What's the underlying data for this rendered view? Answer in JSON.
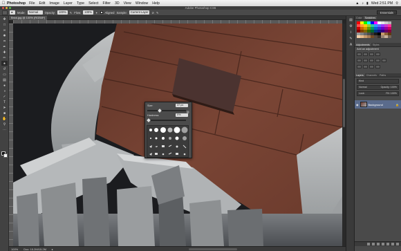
{
  "menubar": {
    "apple": "",
    "app_name": "Photoshop",
    "items": [
      "File",
      "Edit",
      "Image",
      "Layer",
      "Type",
      "Select",
      "Filter",
      "3D",
      "View",
      "Window",
      "Help"
    ],
    "clock": "Wed 2:51 PM"
  },
  "window": {
    "title": "Adobe Photoshop CS6"
  },
  "options_bar": {
    "mode_label": "Mode:",
    "mode_value": "Normal",
    "opacity_label": "Opacity:",
    "opacity_value": "100%",
    "flow_label": "Flow:",
    "flow_value": "100%",
    "aligned_label": "Aligned",
    "sample_label": "Sample:",
    "sample_value": "Current Layer",
    "workspace": "Essentials"
  },
  "document": {
    "tab_title": "Brick.jpg @ 100% (RGB/8*)",
    "zoom": "100%",
    "doc_size": "Doc: 15.2M/15.2M"
  },
  "ruler_ticks": [
    "1150",
    "1200",
    "1250",
    "1300",
    "1350",
    "1400",
    "1450",
    "1500",
    "1550",
    "1600",
    "1650",
    "1700",
    "1750",
    "1800",
    "1850",
    "1900",
    "1950",
    "2000",
    "2050",
    "2100",
    "2150",
    "2200",
    "2250",
    "2300",
    "2350",
    "2400",
    "2450",
    "2500",
    "2550",
    "2600",
    "2650",
    "2700",
    "2750",
    "2800",
    "2850",
    "2900",
    "2950",
    "3000",
    "3050",
    "3100"
  ],
  "brush_popup": {
    "size_label": "Size:",
    "size_value": "37 px",
    "hardness_label": "Hardness:",
    "hardness_value": "0%",
    "size_level": 0.3,
    "hardness_level": 0.0
  },
  "panels": {
    "top_tabs": [
      "Color",
      "Swatches"
    ],
    "adjust_tabs": [
      "Adjustments",
      "Styles"
    ],
    "adjust_label": "Add an adjustment",
    "layer_tabs": [
      "Layers",
      "Channels",
      "Paths"
    ],
    "kind_label": "Kind",
    "blend_mode": "Normal",
    "opacity_label": "Opacity: 100%",
    "lock_label": "Lock:",
    "fill_label": "Fill: 100%",
    "layer_name": "Background"
  },
  "colors": {
    "swatches": [
      "#ff0000",
      "#ffff00",
      "#00ff00",
      "#00ffff",
      "#0000ff",
      "#ff00ff",
      "#ffffff",
      "#e6e6e6",
      "#cccccc",
      "#b3b3b3",
      "#ff4d4d",
      "#ff9933",
      "#ffcc00",
      "#99cc33",
      "#33cc99",
      "#3399ff",
      "#6666ff",
      "#9933ff",
      "#cc33cc",
      "#ff3399",
      "#cc0000",
      "#cc6600",
      "#cc9900",
      "#669900",
      "#009966",
      "#0066cc",
      "#3333cc",
      "#6600cc",
      "#990099",
      "#cc0066",
      "#800000",
      "#804000",
      "#806600",
      "#336600",
      "#006633",
      "#003d80",
      "#1a1a80",
      "#330080",
      "#660066",
      "#80003d",
      "#999999",
      "#808080",
      "#666666",
      "#4d4d4d",
      "#333333",
      "#1a1a1a",
      "#000000",
      "#c69c6d",
      "#8c6239",
      "#603813",
      "#f5d0a9",
      "#e6b98a",
      "#c79a6b",
      "#a67c52",
      "#754c24",
      "#534741",
      "#362f2d",
      "#998675",
      "#c7b299",
      "#736357"
    ]
  }
}
